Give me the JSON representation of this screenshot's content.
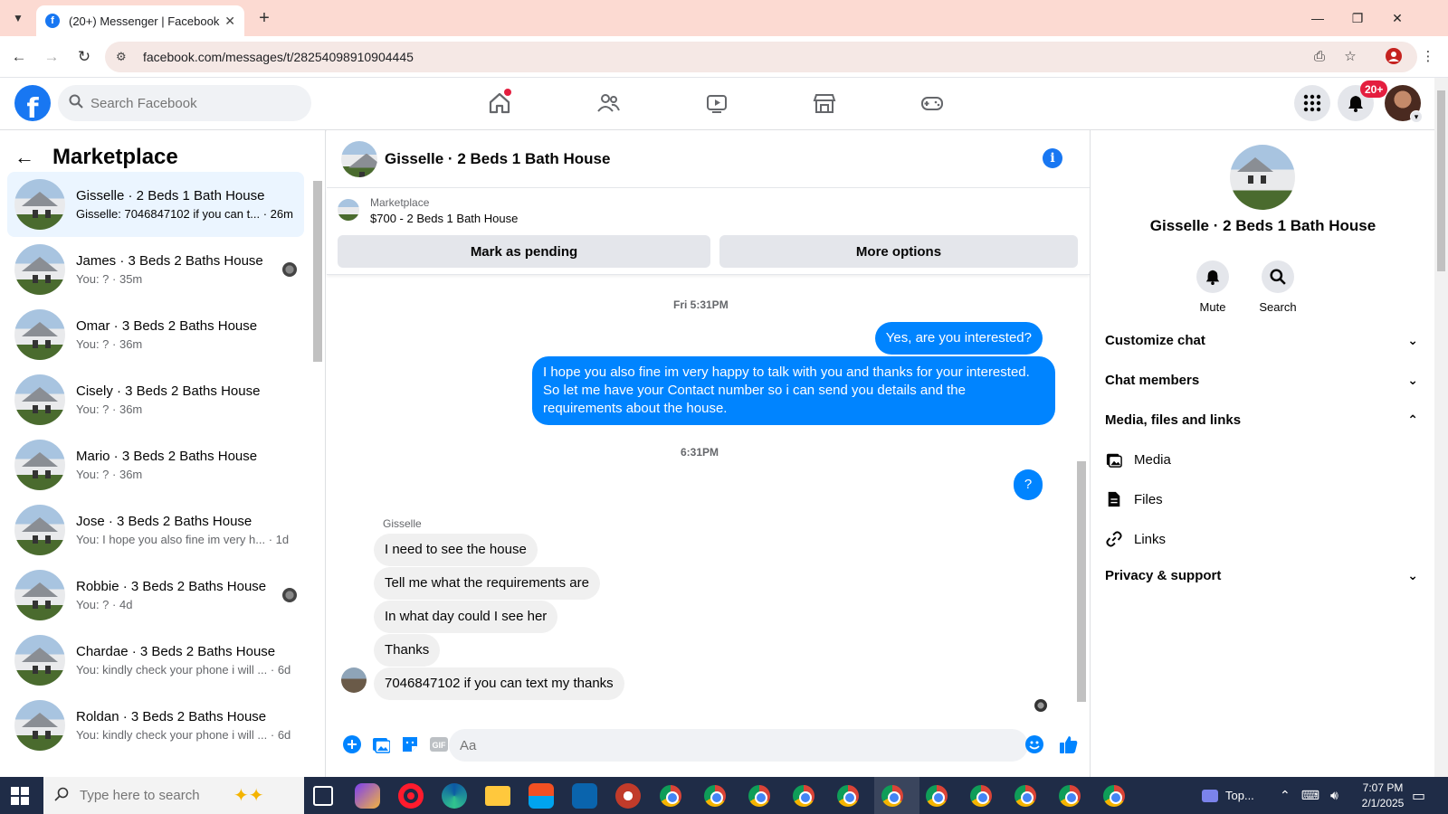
{
  "browser": {
    "tab_title": "(20+) Messenger | Facebook",
    "url": "facebook.com/messages/t/28254098910904445"
  },
  "header": {
    "search_placeholder": "Search Facebook",
    "notifications_badge": "20+"
  },
  "sidebar": {
    "title": "Marketplace",
    "conversations": [
      {
        "name": "Gisselle · 2 Beds 1 Bath House",
        "preview": "Gisselle: 7046847102 if you can t...",
        "time": "· 26m",
        "active": true
      },
      {
        "name": "James · 3 Beds 2 Baths House",
        "preview": "You: ?",
        "time": "· 35m"
      },
      {
        "name": "Omar · 3 Beds 2 Baths House",
        "preview": "You: ?",
        "time": "· 36m"
      },
      {
        "name": "Cisely · 3 Beds 2 Baths House",
        "preview": "You: ?",
        "time": "· 36m"
      },
      {
        "name": "Mario · 3 Beds 2 Baths House",
        "preview": "You: ?",
        "time": "· 36m"
      },
      {
        "name": "Jose · 3 Beds 2 Baths House",
        "preview": "You: I hope you also fine im very h...",
        "time": "· 1d"
      },
      {
        "name": "Robbie · 3 Beds 2 Baths House",
        "preview": "You: ?",
        "time": "· 4d"
      },
      {
        "name": "Chardae · 3 Beds 2 Baths House",
        "preview": "You: kindly check your phone i will ...",
        "time": "· 6d"
      },
      {
        "name": "Roldan · 3 Beds 2 Baths House",
        "preview": "You: kindly check your phone i will ...",
        "time": "· 6d"
      }
    ]
  },
  "chat": {
    "title": "Gisselle · 2 Beds 1 Bath House",
    "listing_category": "Marketplace",
    "listing_title": "$700 - 2 Beds 1 Bath House",
    "mark_pending": "Mark as pending",
    "more_options": "More options",
    "timestamp_1": "Fri 5:31PM",
    "out_1": "Yes, are you interested?",
    "out_2": "I hope you also fine im very happy to talk with you and thanks for your interested. So let me have your Contact number so i can send you details and the requirements about the house.",
    "timestamp_2": "6:31PM",
    "out_3": "?",
    "sender": "Gisselle",
    "in_1": "I need to see the house",
    "in_2": "Tell me what the requirements are",
    "in_3": "In what day could  I see her",
    "in_4": "Thanks",
    "in_5": "7046847102 if you can text my thanks",
    "composer_placeholder": "Aa"
  },
  "right_panel": {
    "name": "Gisselle · 2 Beds 1 Bath House",
    "mute": "Mute",
    "search": "Search",
    "customize_chat": "Customize chat",
    "chat_members": "Chat members",
    "media_files_links": "Media, files and links",
    "media": "Media",
    "files": "Files",
    "links": "Links",
    "privacy_support": "Privacy & support"
  },
  "taskbar": {
    "search_placeholder": "Type here to search",
    "tray_label": "Top...",
    "time": "7:07 PM",
    "date": "2/1/2025"
  },
  "colors": {
    "fb_blue": "#1877f2",
    "messenger_blue": "#0084ff",
    "tab_strip": "#fcdad2"
  }
}
